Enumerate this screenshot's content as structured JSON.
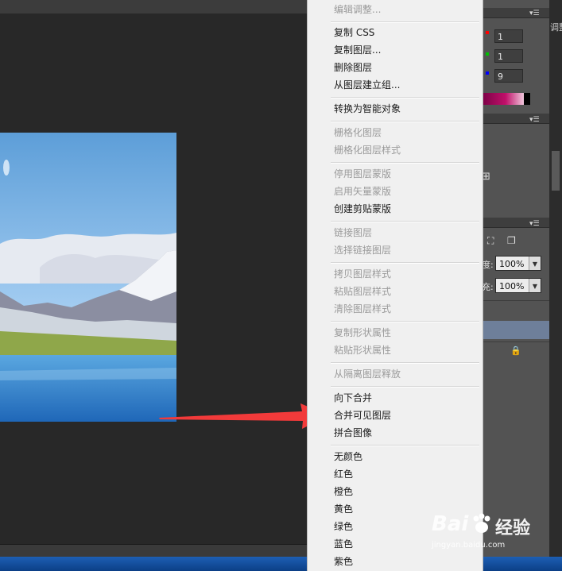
{
  "menu": {
    "items": [
      {
        "label": "编辑调整...",
        "disabled": true
      },
      {
        "label": "复制 CSS",
        "disabled": false
      },
      {
        "label": "复制图层...",
        "disabled": false
      },
      {
        "label": "删除图层",
        "disabled": false
      },
      {
        "label": "从图层建立组...",
        "disabled": false
      },
      {
        "label": "转换为智能对象",
        "disabled": false
      },
      {
        "label": "栅格化图层",
        "disabled": true
      },
      {
        "label": "栅格化图层样式",
        "disabled": true
      },
      {
        "label": "停用图层蒙版",
        "disabled": true
      },
      {
        "label": "启用矢量蒙版",
        "disabled": true
      },
      {
        "label": "创建剪贴蒙版",
        "disabled": false
      },
      {
        "label": "链接图层",
        "disabled": true
      },
      {
        "label": "选择链接图层",
        "disabled": true
      },
      {
        "label": "拷贝图层样式",
        "disabled": true
      },
      {
        "label": "粘贴图层样式",
        "disabled": true
      },
      {
        "label": "清除图层样式",
        "disabled": true
      },
      {
        "label": "复制形状属性",
        "disabled": true
      },
      {
        "label": "粘贴形状属性",
        "disabled": true
      },
      {
        "label": "从隔离图层释放",
        "disabled": true
      },
      {
        "label": "向下合并",
        "disabled": false
      },
      {
        "label": "合并可见图层",
        "disabled": false
      },
      {
        "label": "拼合图像",
        "disabled": false
      },
      {
        "label": "无颜色",
        "disabled": false
      },
      {
        "label": "红色",
        "disabled": false
      },
      {
        "label": "橙色",
        "disabled": false
      },
      {
        "label": "黄色",
        "disabled": false
      },
      {
        "label": "绿色",
        "disabled": false
      },
      {
        "label": "蓝色",
        "disabled": false
      },
      {
        "label": "紫色",
        "disabled": false
      }
    ]
  },
  "color_panel": {
    "r_value": "1",
    "g_value": "1",
    "b_value": "9",
    "r_color": "#ff0000",
    "g_color": "#00c000",
    "b_color": "#0000ff"
  },
  "layers_panel": {
    "opacity_label": "度:",
    "opacity_value": "100%",
    "fill_label": "充:",
    "fill_value": "100%"
  },
  "partial_tab_text": "调整",
  "watermark": {
    "brand": "Bai",
    "brand_suffix": "经验",
    "url": "jingyan.baidu.com"
  },
  "colors": {
    "arrow": "#f23a3a",
    "menu_bg": "#f0f0f0",
    "panel_bg": "#535353",
    "canvas_bg": "#282828",
    "selected_layer": "#6e7f9a"
  }
}
